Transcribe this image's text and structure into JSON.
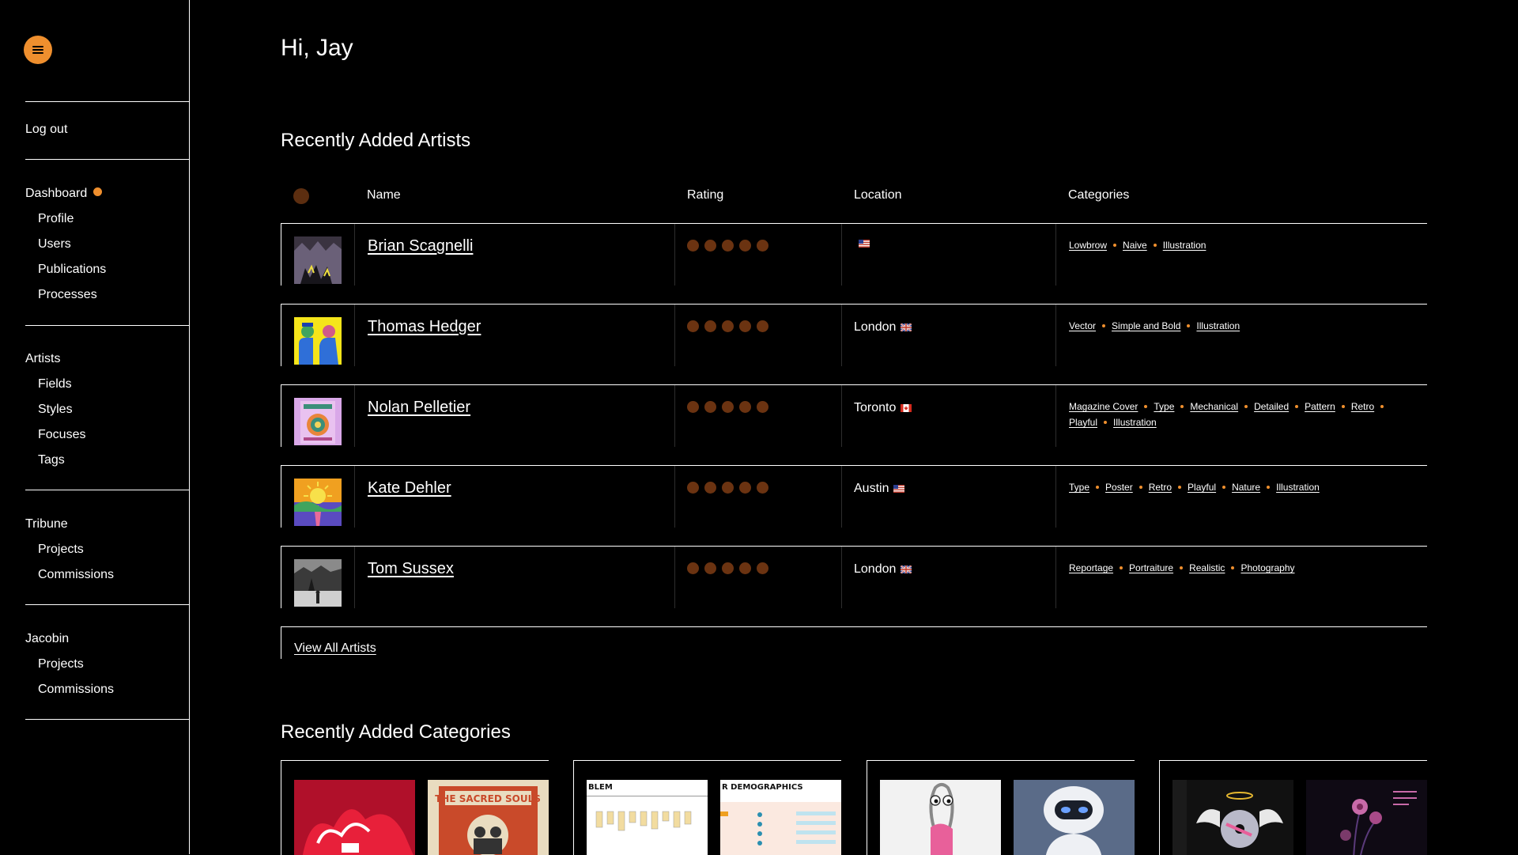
{
  "sidebar": {
    "logout": "Log out",
    "groups": [
      {
        "title": "Dashboard",
        "items": [
          "Profile",
          "Users",
          "Publications",
          "Processes"
        ]
      },
      {
        "title": "Artists",
        "items": [
          "Fields",
          "Styles",
          "Focuses",
          "Tags"
        ]
      },
      {
        "title": "Tribune",
        "items": [
          "Projects",
          "Commissions"
        ]
      },
      {
        "title": "Jacobin",
        "items": [
          "Projects",
          "Commissions"
        ]
      }
    ]
  },
  "greeting": "Hi, Jay",
  "artists_section": {
    "title": "Recently Added Artists",
    "columns": {
      "name": "Name",
      "rating": "Rating",
      "location": "Location",
      "categories": "Categories"
    },
    "rows": [
      {
        "name": "Brian Scagnelli",
        "rating": 5,
        "location": "",
        "flag": "us",
        "categories": [
          "Lowbrow",
          "Naive",
          "Illustration"
        ]
      },
      {
        "name": "Thomas Hedger",
        "rating": 5,
        "location": "London",
        "flag": "uk",
        "categories": [
          "Vector",
          "Simple and Bold",
          "Illustration"
        ]
      },
      {
        "name": "Nolan Pelletier",
        "rating": 5,
        "location": "Toronto",
        "flag": "ca",
        "categories": [
          "Magazine Cover",
          "Type",
          "Mechanical",
          "Detailed",
          "Pattern",
          "Retro",
          "Playful",
          "Illustration"
        ]
      },
      {
        "name": "Kate Dehler",
        "rating": 5,
        "location": "Austin",
        "flag": "us",
        "categories": [
          "Type",
          "Poster",
          "Retro",
          "Playful",
          "Nature",
          "Illustration"
        ]
      },
      {
        "name": "Tom Sussex",
        "rating": 5,
        "location": "London",
        "flag": "uk",
        "categories": [
          "Reportage",
          "Portraiture",
          "Realistic",
          "Photography"
        ]
      }
    ],
    "view_all": "View All Artists"
  },
  "categories_section": {
    "title": "Recently Added Categories"
  },
  "colors": {
    "accent": "#ef8f2e",
    "star": "#6b3311",
    "background": "#000000"
  }
}
